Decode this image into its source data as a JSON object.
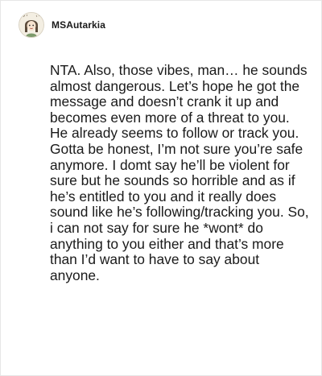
{
  "post": {
    "author": {
      "name": "MSAutarkia",
      "avatar_icon": "cartoon-avatar-icon"
    },
    "body": "NTA. Also, those vibes, man… he sounds almost dangerous. Let’s hope he got the message and doesn’t crank it up and becomes even more of a threat to you. He already seems to follow or track you. Gotta be honest, I’m not sure you’re safe anymore. I domt say he’ll be violent for sure but he sounds so horrible and as if he’s entitled to you and it really does sound like he’s following/tracking you. So, i can not say for sure he *wont* do anything to you either and that’s more than I’d want to have to say about anyone."
  }
}
